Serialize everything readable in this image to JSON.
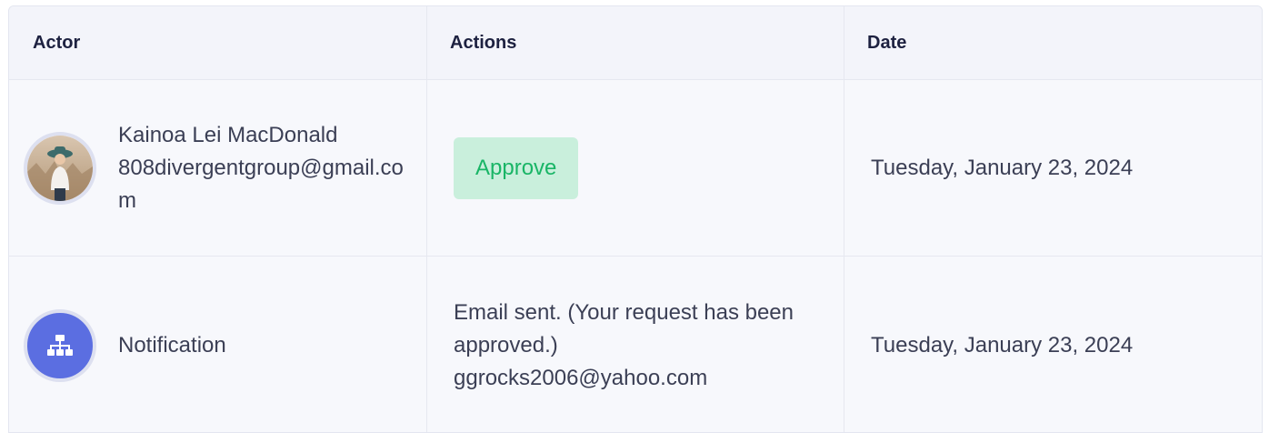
{
  "table": {
    "headers": {
      "actor": "Actor",
      "actions": "Actions",
      "date": "Date"
    },
    "rows": [
      {
        "actor_name": "Kainoa Lei MacDonald",
        "actor_email": "808divergentgroup@gmail.com",
        "action_badge": "Approve",
        "date": "Tuesday, January 23, 2024",
        "avatar_icon": "user-photo-avatar"
      },
      {
        "actor_name": "Notification",
        "action_lines": [
          "Email sent. (Your request has been approved.)",
          "ggrocks2006@yahoo.com"
        ],
        "date": "Tuesday, January 23, 2024",
        "avatar_icon": "sitemap-icon"
      }
    ]
  },
  "colors": {
    "approve_bg": "#c9efdc",
    "approve_text": "#19b566",
    "notification_avatar": "#5b6ee1"
  }
}
